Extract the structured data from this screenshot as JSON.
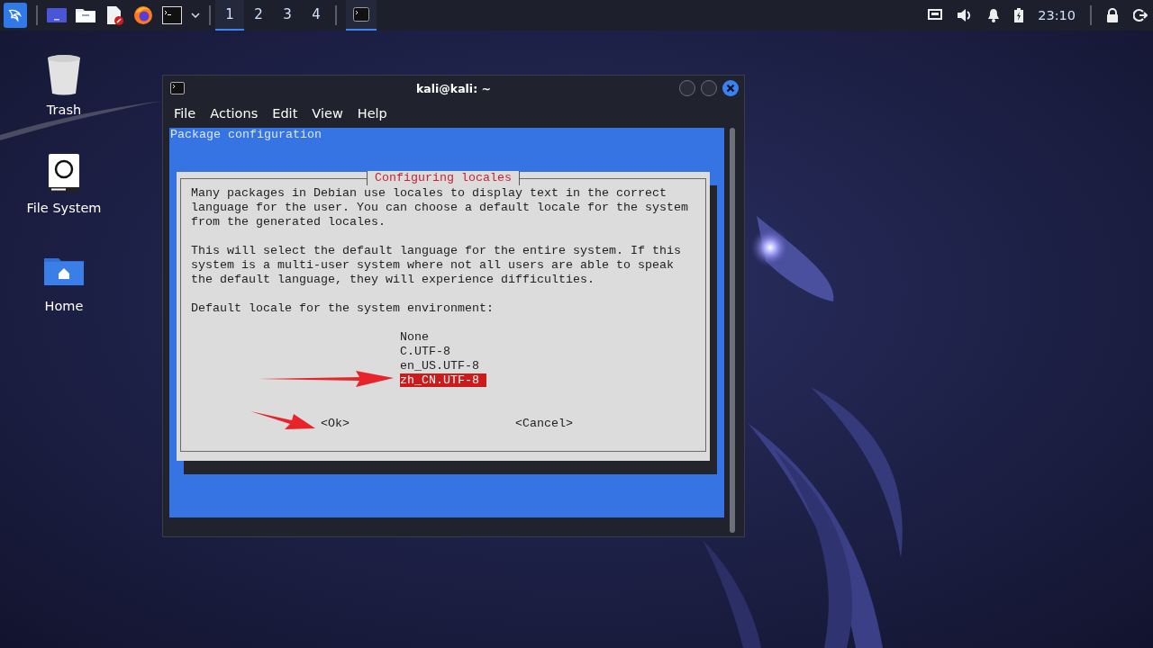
{
  "taskbar": {
    "workspaces": [
      {
        "label": "1",
        "selected": true
      },
      {
        "label": "2",
        "selected": false
      },
      {
        "label": "3",
        "selected": false
      },
      {
        "label": "4",
        "selected": false
      }
    ],
    "clock": "23:10"
  },
  "desktop_icons": [
    {
      "label": "Trash",
      "kind": "trash"
    },
    {
      "label": "File System",
      "kind": "drive"
    },
    {
      "label": "Home",
      "kind": "home"
    }
  ],
  "window": {
    "title": "kali@kali: ~",
    "menu": [
      "File",
      "Actions",
      "Edit",
      "View",
      "Help"
    ],
    "terminal": {
      "header": "Package configuration",
      "dialog": {
        "title": "Configuring locales",
        "paragraphs": [
          "Many packages in Debian use locales to display text in the correct\nlanguage for the user. You can choose a default locale for the system\nfrom the generated locales.",
          "This will select the default language for the entire system. If this\nsystem is a multi-user system where not all users are able to speak\nthe default language, they will experience difficulties.",
          "Default locale for the system environment:"
        ],
        "options": [
          {
            "label": "None",
            "selected": false
          },
          {
            "label": "C.UTF-8",
            "selected": false
          },
          {
            "label": "en_US.UTF-8",
            "selected": false
          },
          {
            "label": "zh_CN.UTF-8",
            "selected": true
          }
        ],
        "buttons": [
          {
            "label": "<Ok>"
          },
          {
            "label": "<Cancel>"
          }
        ]
      }
    }
  }
}
